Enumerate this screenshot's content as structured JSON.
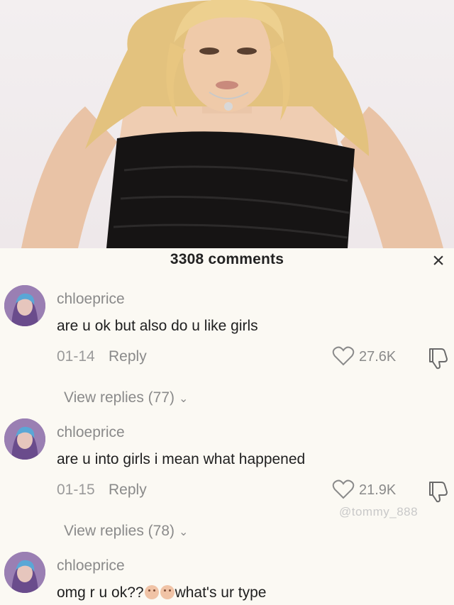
{
  "header": {
    "comments_count_label": "3308 comments",
    "close_label": "×"
  },
  "comments": [
    {
      "username": "chloeprice",
      "text": "are u ok but also do u like girls",
      "date": "01-14",
      "reply_label": "Reply",
      "likes": "27.6K",
      "view_replies": "View replies (77)"
    },
    {
      "username": "chloeprice",
      "text": "are u into girls i mean what happened",
      "date": "01-15",
      "reply_label": "Reply",
      "likes": "21.9K",
      "view_replies": "View replies (78)"
    },
    {
      "username": "chloeprice",
      "text_before_emoji": "omg r u ok??",
      "text_after_emoji": "what's ur type",
      "emoji_icons": [
        "worried-face-icon",
        "worried-face-icon"
      ]
    }
  ],
  "watermark": "@tommy_888",
  "colors": {
    "sheet_background": "#fbf9f3",
    "secondary_text": "#8a8a8a",
    "primary_text": "#1f1f1f"
  }
}
